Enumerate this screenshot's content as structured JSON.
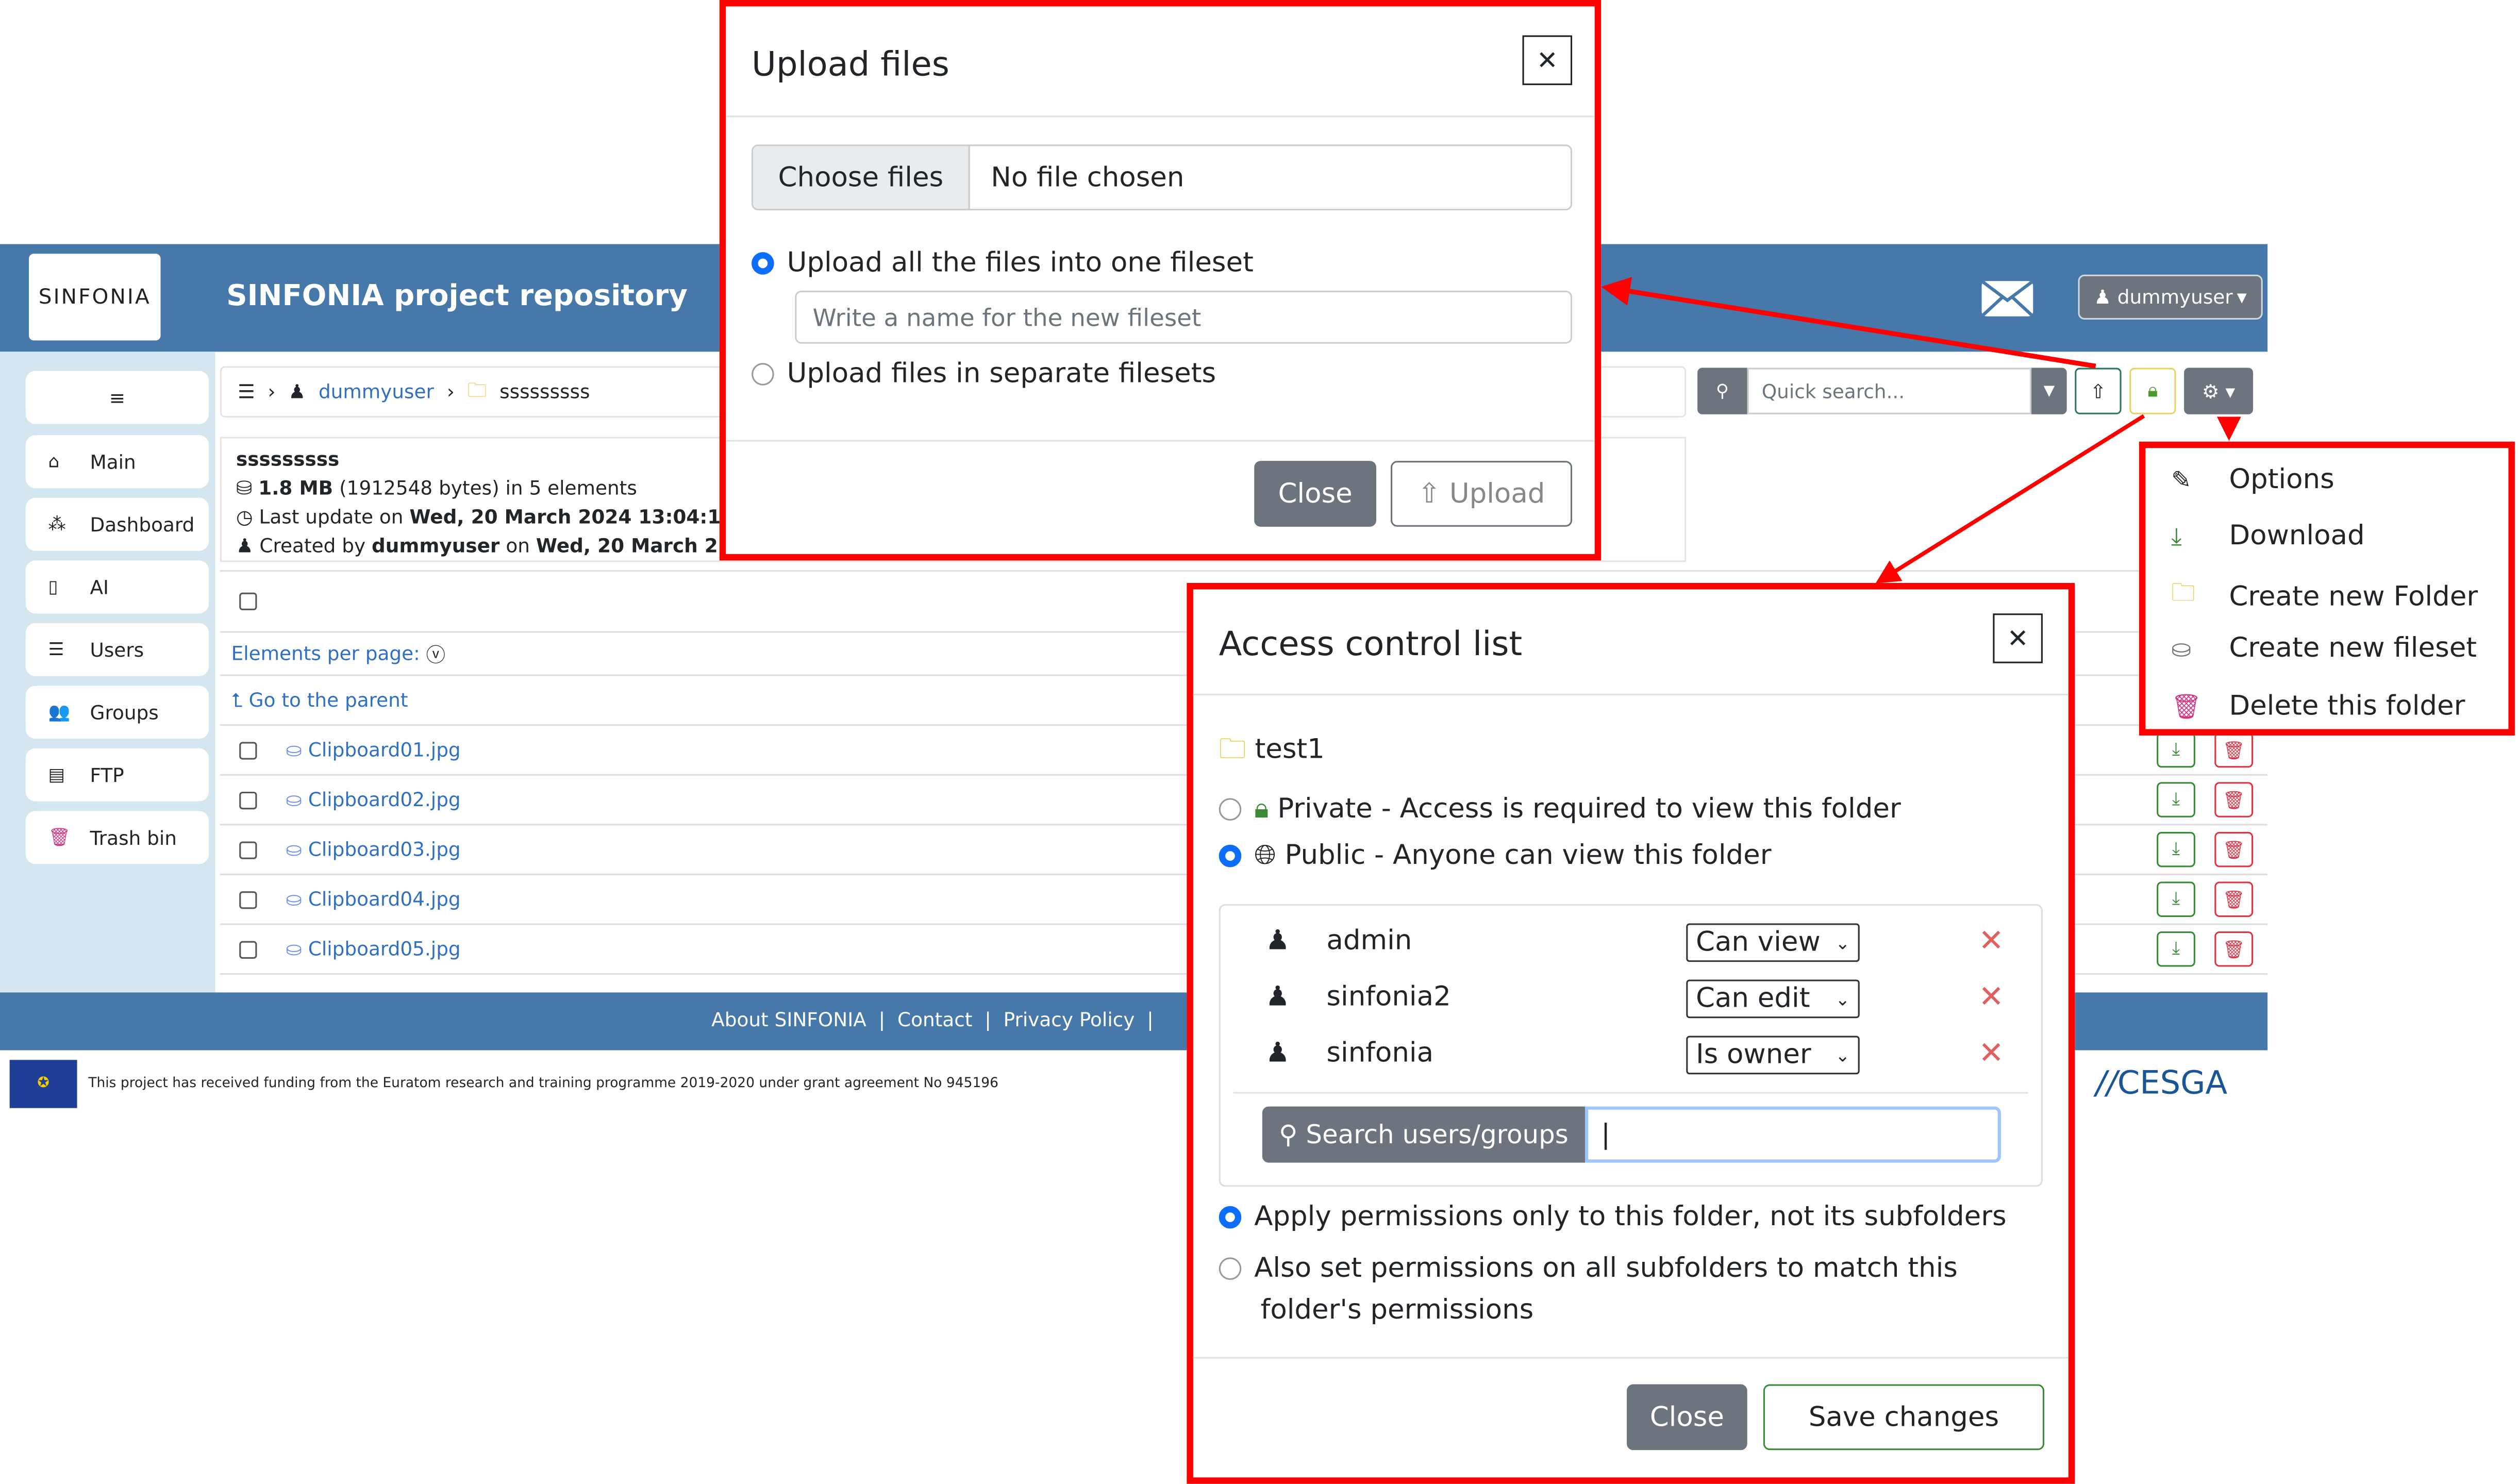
{
  "header": {
    "title": "SINFONIA project repository",
    "logo_text": "SINFONIA",
    "user": "dummyuser",
    "mail_icon": "envelope-icon"
  },
  "sidebar": {
    "items": [
      {
        "label": "Main",
        "icon": "home-icon"
      },
      {
        "label": "Dashboard",
        "icon": "sitemap-icon"
      },
      {
        "label": "AI",
        "icon": "file-ai-icon"
      },
      {
        "label": "Users",
        "icon": "users-list-icon"
      },
      {
        "label": "Groups",
        "icon": "group-icon"
      },
      {
        "label": "FTP",
        "icon": "database-icon"
      },
      {
        "label": "Trash bin",
        "icon": "trash-icon"
      }
    ]
  },
  "breadcrumb": {
    "user": "dummyuser",
    "folder": "sssssssss"
  },
  "toolbar": {
    "search_placeholder": "Quick search..."
  },
  "info": {
    "name": "sssssssss",
    "size": "1.8 MB",
    "bytes": "(1912548 bytes) in 5 elements",
    "update_prefix": "Last update on",
    "update_date": "Wed, 20 March 2024 13:04:1",
    "created_prefix": "Created by",
    "created_user": "dummyuser",
    "created_on": "on",
    "created_date": "Wed, 20 March 2"
  },
  "list": {
    "per_page": "Elements per page:",
    "parent": "Go to the parent",
    "files": [
      "Clipboard01.jpg",
      "Clipboard02.jpg",
      "Clipboard03.jpg",
      "Clipboard04.jpg",
      "Clipboard05.jpg"
    ]
  },
  "footer": {
    "links": [
      "About SINFONIA",
      "Contact",
      "Privacy Policy"
    ],
    "funding": "This project has received funding from the Euratom research and training programme 2019-2020 under grant agreement No 945196",
    "partner_logo": "CESGA"
  },
  "upload_modal": {
    "title": "Upload files",
    "choose": "Choose files",
    "no_file": "No file chosen",
    "option1": "Upload all the files into one fileset",
    "fileset_placeholder": "Write a name for the new fileset",
    "option2": "Upload files in separate filesets",
    "close": "Close",
    "upload": "Upload"
  },
  "gear_menu": {
    "items": [
      {
        "label": "Options",
        "icon": "pencil-icon"
      },
      {
        "label": "Download",
        "icon": "download-icon"
      },
      {
        "label": "Create new Folder",
        "icon": "folder-icon"
      },
      {
        "label": "Create new fileset",
        "icon": "fileset-icon"
      },
      {
        "label": "Delete this folder",
        "icon": "trash-icon"
      }
    ]
  },
  "acl_modal": {
    "title": "Access control list",
    "folder": "test1",
    "private": "Private - Access is required to view this folder",
    "public": "Public - Anyone can view this folder",
    "entries": [
      {
        "user": "admin",
        "perm": "Can view"
      },
      {
        "user": "sinfonia2",
        "perm": "Can edit"
      },
      {
        "user": "sinfonia",
        "perm": "Is owner"
      }
    ],
    "search_btn": "Search users/groups",
    "apply_only": "Apply permissions only to this folder, not its subfolders",
    "apply_all": "Also set permissions on all subfolders to match this folder's permissions",
    "close": "Close",
    "save": "Save changes"
  },
  "colors": {
    "header": "#4679aa",
    "sidebar": "#d4e7f0",
    "annotation": "#ff0000",
    "primary": "#0d6efd"
  }
}
